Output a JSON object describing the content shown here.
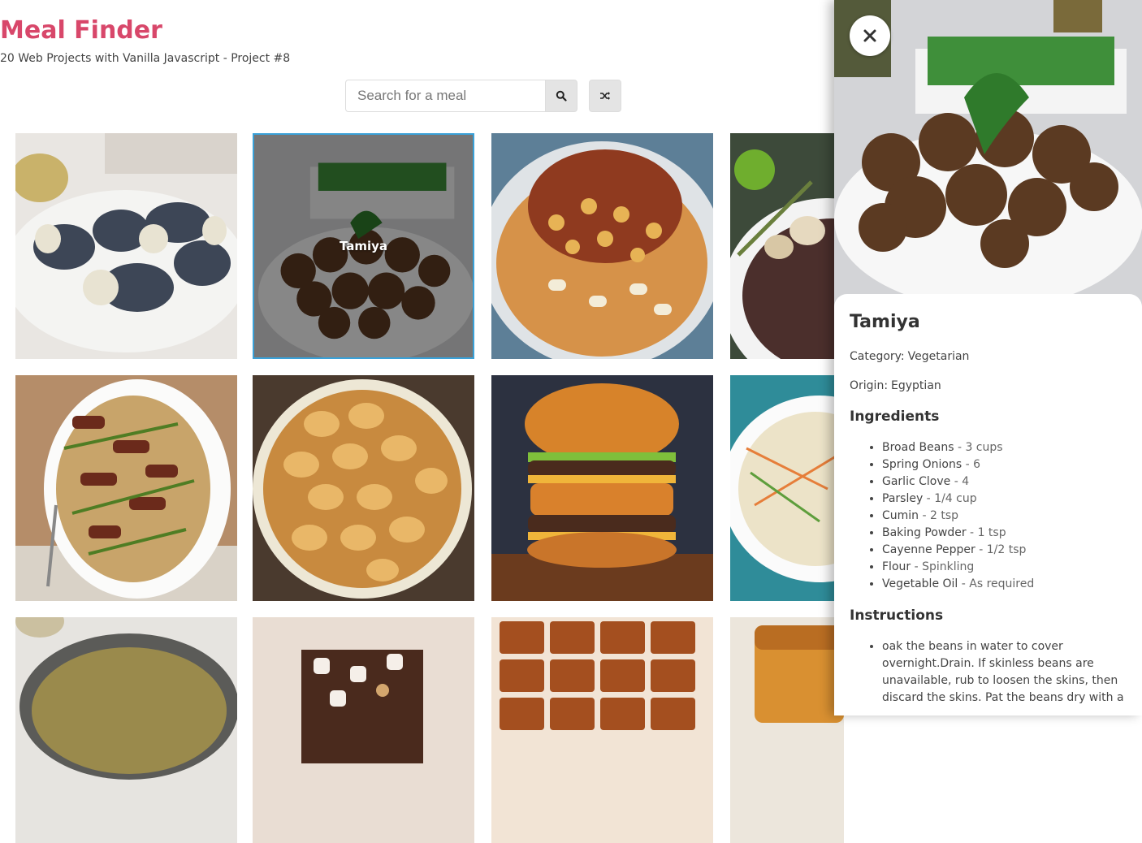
{
  "header": {
    "title": "Meal Finder",
    "subtitle": "20 Web Projects with Vanilla Javascript - Project #8"
  },
  "search": {
    "placeholder": "Search for a meal",
    "search_icon": "search-icon",
    "random_icon": "shuffle-icon"
  },
  "meals": [
    {
      "name": "",
      "image": "rolled-fish-photo"
    },
    {
      "name": "Tamiya",
      "image": "tamiya-photo",
      "active": true
    },
    {
      "name": "",
      "image": "koshari-photo"
    },
    {
      "name": "",
      "image": "roast-photo"
    },
    {
      "name": "",
      "image": "beef-asparagus-photo"
    },
    {
      "name": "",
      "image": "cabbage-rolls-photo"
    },
    {
      "name": "",
      "image": "burger-photo"
    },
    {
      "name": "",
      "image": "noodle-salad-photo"
    },
    {
      "name": "",
      "image": "lentils-photo"
    },
    {
      "name": "",
      "image": "rocky-road-photo"
    },
    {
      "name": "",
      "image": "brownies-photo"
    },
    {
      "name": "",
      "image": "loaf-cake-photo"
    }
  ],
  "detail": {
    "close_icon": "close-icon",
    "name": "Tamiya",
    "category_label": "Category:",
    "category": "Vegetarian",
    "origin_label": "Origin:",
    "origin": "Egyptian",
    "ingredients_heading": "Ingredients",
    "ingredients": [
      {
        "name": "Broad Beans",
        "qty": "3 cups"
      },
      {
        "name": "Spring Onions",
        "qty": "6"
      },
      {
        "name": "Garlic Clove",
        "qty": "4"
      },
      {
        "name": "Parsley",
        "qty": "1/4 cup"
      },
      {
        "name": "Cumin",
        "qty": "2 tsp"
      },
      {
        "name": "Baking Powder",
        "qty": "1 tsp"
      },
      {
        "name": "Cayenne Pepper",
        "qty": "1/2 tsp"
      },
      {
        "name": "Flour",
        "qty": "Spinkling"
      },
      {
        "name": "Vegetable Oil",
        "qty": "As required"
      }
    ],
    "instructions_heading": "Instructions",
    "instructions": [
      "oak the beans in water to cover overnight.Drain. If skinless beans are unavailable, rub to loosen the skins, then discard the skins. Pat the beans dry with a"
    ]
  },
  "colors": {
    "accent": "#d8476a",
    "active_border": "#3aa1d8"
  }
}
